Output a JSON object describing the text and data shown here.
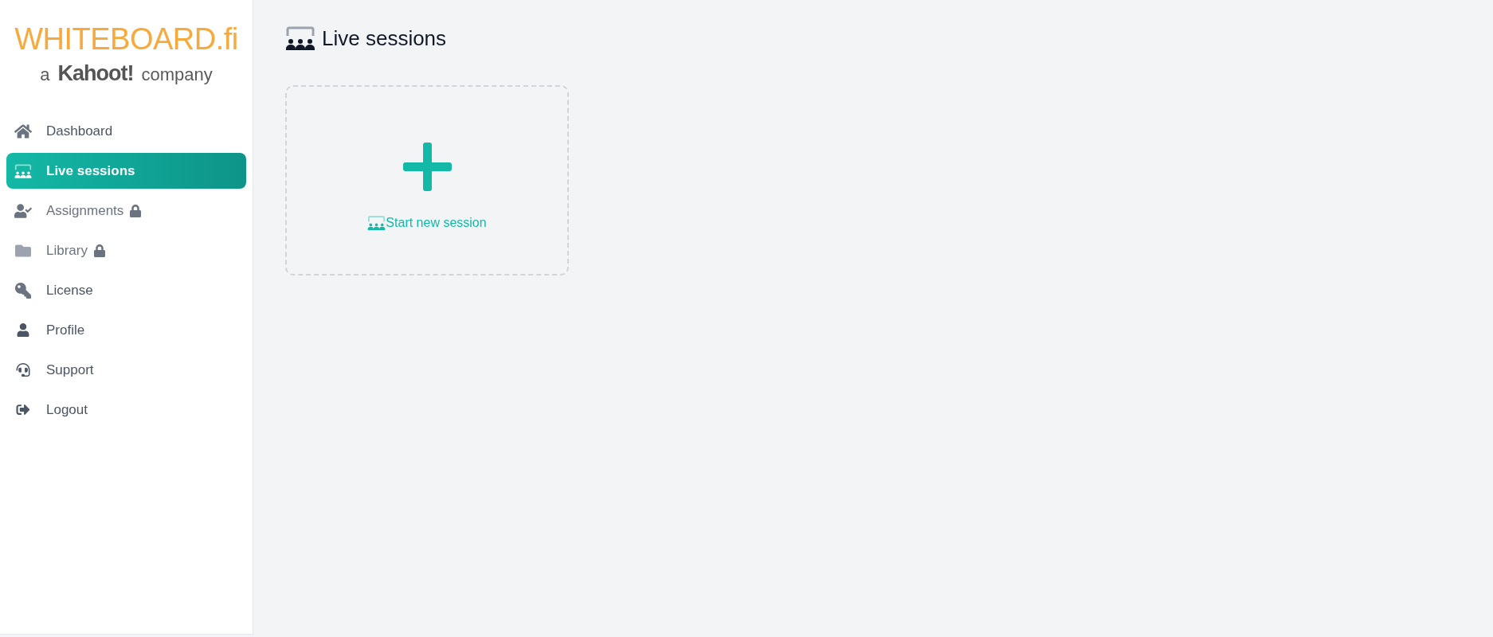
{
  "sidebar": {
    "logo": {
      "wordmark": "WHITEBOARD.fi",
      "tagline_prefix": "a",
      "tagline_brand": "Kahoot!",
      "tagline_suffix": "company"
    },
    "items": [
      {
        "label": "Dashboard",
        "selected": false,
        "locked": false
      },
      {
        "label": "Live sessions",
        "selected": true,
        "locked": false
      },
      {
        "label": "Assignments",
        "selected": false,
        "locked": true
      },
      {
        "label": "Library",
        "selected": false,
        "locked": true
      },
      {
        "label": "License",
        "selected": false,
        "locked": false
      },
      {
        "label": "Profile",
        "selected": false,
        "locked": false
      },
      {
        "label": "Support",
        "selected": false,
        "locked": false
      },
      {
        "label": "Logout",
        "selected": false,
        "locked": false
      }
    ]
  },
  "main": {
    "title": "Live sessions",
    "new_session_card": {
      "label": "Start new session"
    }
  }
}
